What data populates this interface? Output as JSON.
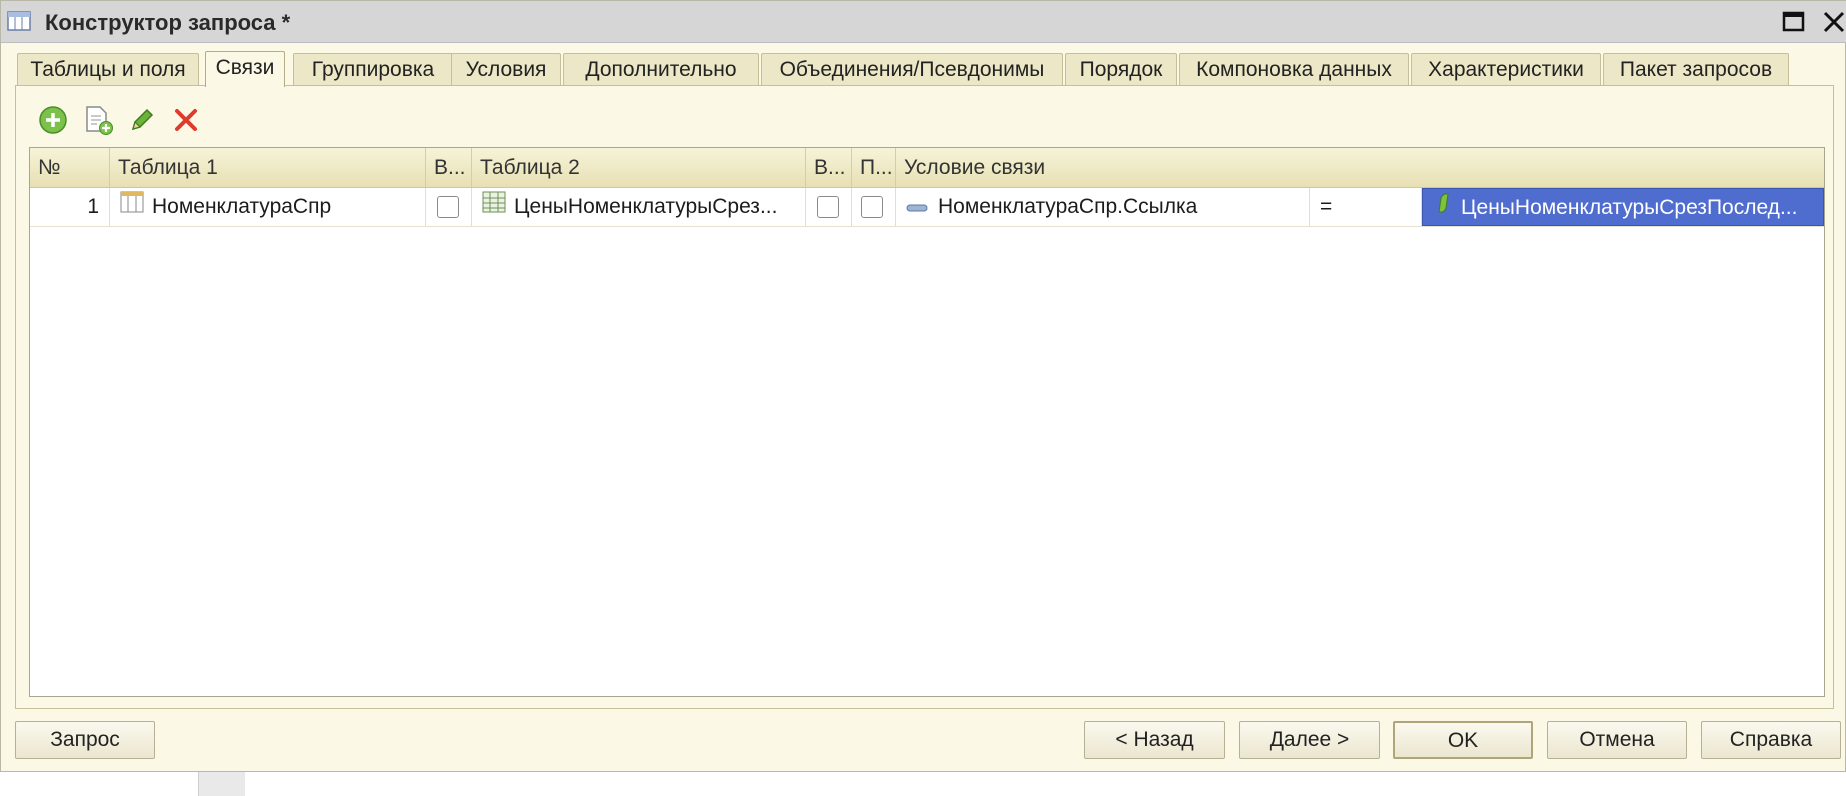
{
  "window": {
    "title": "Конструктор запроса *"
  },
  "tabs": [
    {
      "label": "Таблицы и поля"
    },
    {
      "label": "Связи",
      "active": true
    },
    {
      "label": "Группировка"
    },
    {
      "label": "Условия"
    },
    {
      "label": "Дополнительно"
    },
    {
      "label": "Объединения/Псевдонимы"
    },
    {
      "label": "Порядок"
    },
    {
      "label": "Компоновка данных"
    },
    {
      "label": "Характеристики"
    },
    {
      "label": "Пакет запросов"
    }
  ],
  "toolbar": {
    "add_icon": "add-circle-icon",
    "copy_icon": "copy-document-icon",
    "edit_icon": "pencil-icon",
    "delete_icon": "delete-x-icon"
  },
  "table": {
    "headers": {
      "num": "№",
      "table1": "Таблица 1",
      "all1": "В...",
      "table2": "Таблица 2",
      "all2": "В...",
      "custom": "П...",
      "condition": "Условие связи"
    },
    "rows": [
      {
        "num": "1",
        "table1": "НоменклатураСпр",
        "all1": false,
        "table2": "ЦеныНоменклатурыСрез...",
        "all2": false,
        "custom": false,
        "cond_left": "НоменклатураСпр.Ссылка",
        "cond_op": "=",
        "cond_right": "ЦеныНоменклатурыСрезПослед..."
      }
    ]
  },
  "buttons": {
    "query": "Запрос",
    "back": "< Назад",
    "next": "Далее >",
    "ok": "OK",
    "cancel": "Отмена",
    "help": "Справка"
  },
  "colors": {
    "selection": "#4f6ccf",
    "background": "#fbf8e6"
  }
}
